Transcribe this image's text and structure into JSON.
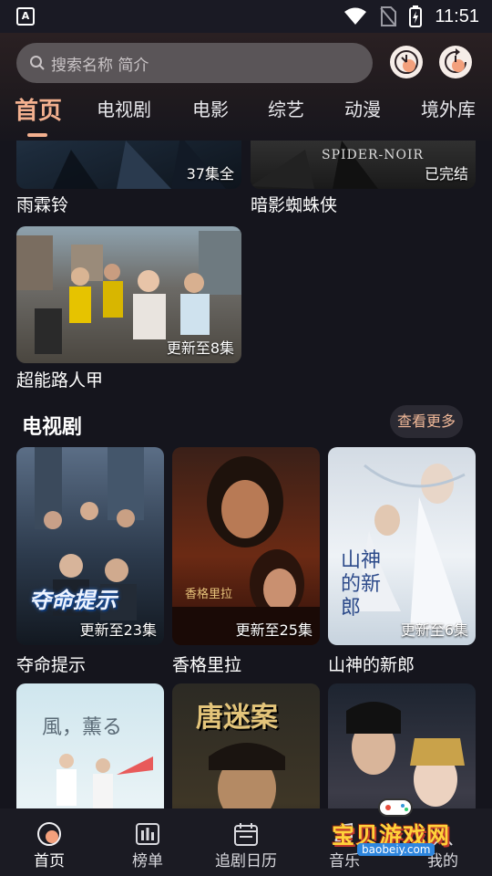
{
  "status_bar": {
    "time": "11:51",
    "app_badge": "A"
  },
  "search": {
    "placeholder": "搜索名称 简介"
  },
  "tabs": [
    {
      "label": "首页",
      "active": true
    },
    {
      "label": "电视剧"
    },
    {
      "label": "电影"
    },
    {
      "label": "综艺"
    },
    {
      "label": "动漫"
    },
    {
      "label": "境外库"
    }
  ],
  "top_cards": [
    {
      "title": "雨霖铃",
      "badge": "37集全"
    },
    {
      "title": "暗影蜘蛛侠",
      "badge": "已完结",
      "poster_text": "SPIDER-NOIR"
    },
    {
      "title": "超能路人甲",
      "badge": "更新至8集"
    }
  ],
  "tv_section": {
    "title": "电视剧",
    "more_label": "查看更多",
    "cards": [
      {
        "title": "夺命提示",
        "badge": "更新至23集",
        "poster_text": "夺命提示"
      },
      {
        "title": "香格里拉",
        "badge": "更新至25集",
        "poster_text": "香格里拉"
      },
      {
        "title": "山神的新郎",
        "badge": "更新至6集",
        "poster_text": "山神的新郎"
      }
    ],
    "row2_posters": [
      {
        "poster_text": "風，薰る"
      },
      {
        "poster_text": "唐迷案"
      },
      {
        "poster_text": ""
      }
    ]
  },
  "bottom_nav": [
    {
      "label": "首页",
      "icon": "home-icon",
      "active": true
    },
    {
      "label": "榜单",
      "icon": "chart-icon"
    },
    {
      "label": "追剧日历",
      "icon": "calendar-icon"
    },
    {
      "label": "音乐",
      "icon": "music-icon"
    },
    {
      "label": "我的",
      "icon": "profile-icon"
    }
  ],
  "watermark": {
    "text": "宝贝游戏网",
    "url": "baobeiy.com"
  },
  "colors": {
    "accent": "#f3b08f",
    "background": "#15151d"
  }
}
